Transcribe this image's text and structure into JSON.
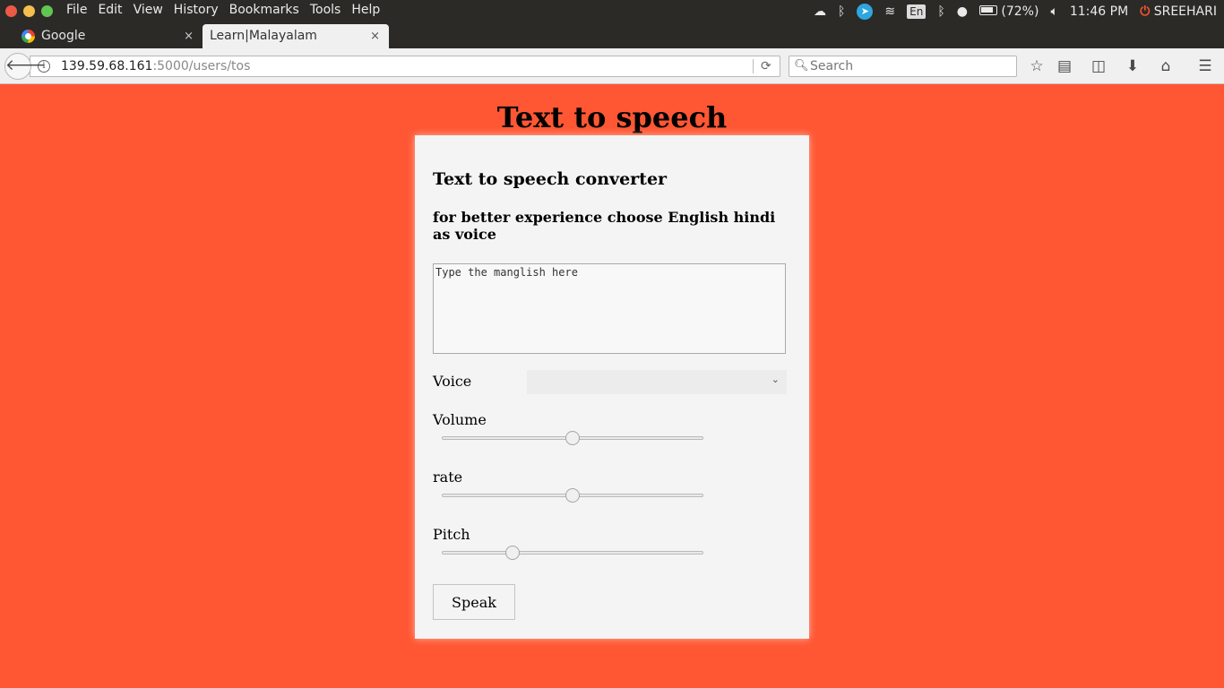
{
  "system_bar": {
    "menu": [
      "File",
      "Edit",
      "View",
      "History",
      "Bookmarks",
      "Tools",
      "Help"
    ],
    "keyboard_layout": "En",
    "battery": "(72%)",
    "clock": "11:46 PM",
    "user": "SREEHARI"
  },
  "tabs": [
    {
      "title": "Google",
      "active": false,
      "close": "×"
    },
    {
      "title": "Learn|Malayalam",
      "active": true,
      "close": "×"
    }
  ],
  "new_tab": "+",
  "nav": {
    "url_host": "139.59.68.161",
    "url_rest": ":5000/users/tos",
    "search_placeholder": "Search"
  },
  "page": {
    "title": "Text to speech",
    "card_heading": "Text to speech converter",
    "card_subheading": "for better experience choose English hindi as voice",
    "textarea_placeholder": "Type the manglish here",
    "voice_label": "Voice",
    "voice_selected": "",
    "volume_label": "Volume",
    "volume_value": 0.5,
    "rate_label": "rate",
    "rate_value": 0.5,
    "pitch_label": "Pitch",
    "pitch_value": 0.27,
    "speak_label": "Speak"
  },
  "colors": {
    "page_background": "#ff5733",
    "card_background": "#f4f4f4"
  }
}
